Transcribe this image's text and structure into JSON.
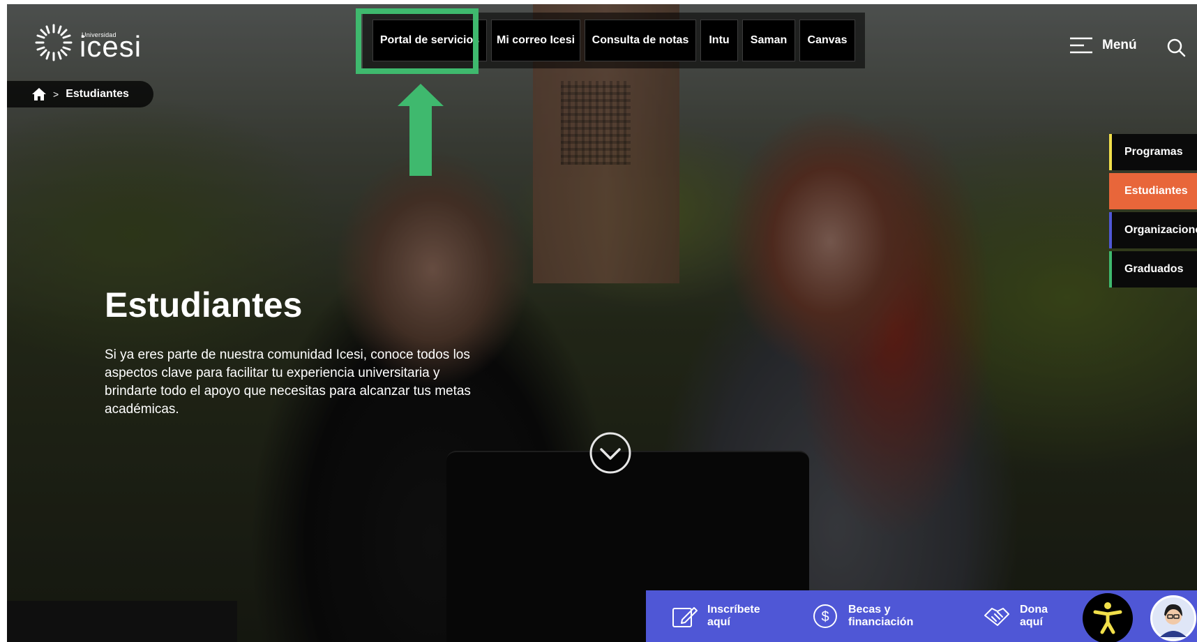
{
  "logo": {
    "small": "Universidad",
    "big": "icesi"
  },
  "quicklinks": [
    {
      "label": "Portal de servicios"
    },
    {
      "label": "Mi correo Icesi"
    },
    {
      "label": "Consulta de notas"
    },
    {
      "label": "Intu"
    },
    {
      "label": "Saman"
    },
    {
      "label": "Canvas"
    }
  ],
  "menu": {
    "label": "Menú"
  },
  "breadcrumb": {
    "separator": ">",
    "current": "Estudiantes"
  },
  "sidetabs": [
    {
      "label": "Programas",
      "accent": "#f2e04a"
    },
    {
      "label": "Estudiantes",
      "accent": "#e8663a"
    },
    {
      "label": "Organizaciones",
      "accent": "#4f57d6"
    },
    {
      "label": "Graduados",
      "accent": "#3fb96e"
    }
  ],
  "hero": {
    "title": "Estudiantes",
    "text": "Si ya eres parte de nuestra comunidad Icesi, conoce todos los aspectos clave para facilitar tu experiencia universitaria y brindarte todo el apoyo que necesitas para alcanzar tus metas académicas."
  },
  "bottombar": {
    "items": [
      {
        "label": "Inscríbete\naquí",
        "icon": "edit-icon"
      },
      {
        "label": "Becas y\nfinanciación",
        "icon": "dollar-icon"
      },
      {
        "label": "Dona\naquí",
        "icon": "handshake-icon"
      }
    ]
  },
  "colors": {
    "highlight": "#3fb96e",
    "active_tab": "#e8663a",
    "bottom_bar": "#4f57d6"
  }
}
